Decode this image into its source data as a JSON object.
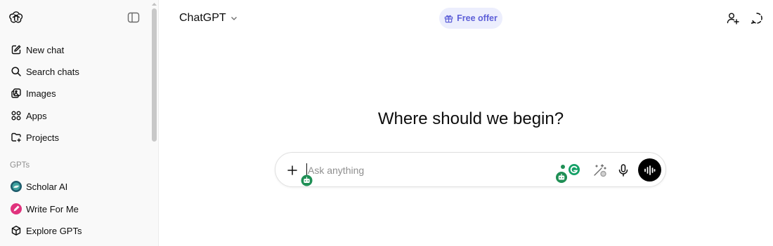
{
  "sidebar": {
    "items": [
      {
        "label": "New chat",
        "icon": "edit-icon"
      },
      {
        "label": "Search chats",
        "icon": "search-icon"
      },
      {
        "label": "Images",
        "icon": "images-icon"
      },
      {
        "label": "Apps",
        "icon": "apps-icon"
      },
      {
        "label": "Projects",
        "icon": "projects-icon"
      }
    ],
    "section_label": "GPTs",
    "gpts": [
      {
        "label": "Scholar AI",
        "icon": "scholar-ai-avatar"
      },
      {
        "label": "Write For Me",
        "icon": "write-for-me-avatar"
      },
      {
        "label": "Explore GPTs",
        "icon": "cube-icon"
      }
    ]
  },
  "header": {
    "model_label": "ChatGPT",
    "free_offer_label": "Free offer"
  },
  "main": {
    "headline": "Where should we begin?",
    "composer": {
      "placeholder": "Ask anything"
    }
  },
  "colors": {
    "accent": "#5d5fd8",
    "badge_green": "#1f8f55",
    "sidebar_bg": "#f9f9f9"
  }
}
